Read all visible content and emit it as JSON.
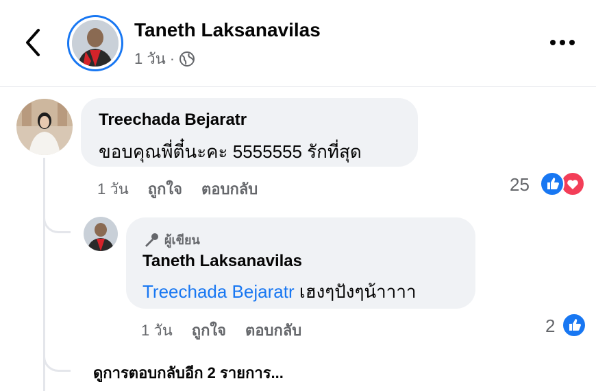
{
  "header": {
    "author_name": "Taneth Laksanavilas",
    "time": "1 วัน",
    "separator": "·"
  },
  "comment": {
    "author": "Treechada Bejaratr",
    "text": "ขอบคุณพี่ตี๋นะคะ 5555555 รักที่สุด",
    "time": "1 วัน",
    "like_label": "ถูกใจ",
    "reply_label": "ตอบกลับ",
    "reaction_count": "25",
    "reactions": [
      "like-icon",
      "love-icon"
    ]
  },
  "reply": {
    "badge": "ผู้เขียน",
    "author": "Taneth Laksanavilas",
    "mention": "Treechada Bejaratr",
    "text": " เฮงๆปังๆน้าาาา",
    "time": "1 วัน",
    "like_label": "ถูกใจ",
    "reply_label": "ตอบกลับ",
    "reaction_count": "2",
    "reactions": [
      "like-icon"
    ]
  },
  "view_more": "ดูการตอบกลับอีก 2 รายการ...",
  "colors": {
    "accent": "#1877f2",
    "love": "#f33e58",
    "bubble": "#f0f2f5",
    "secondary_text": "#65676b"
  }
}
